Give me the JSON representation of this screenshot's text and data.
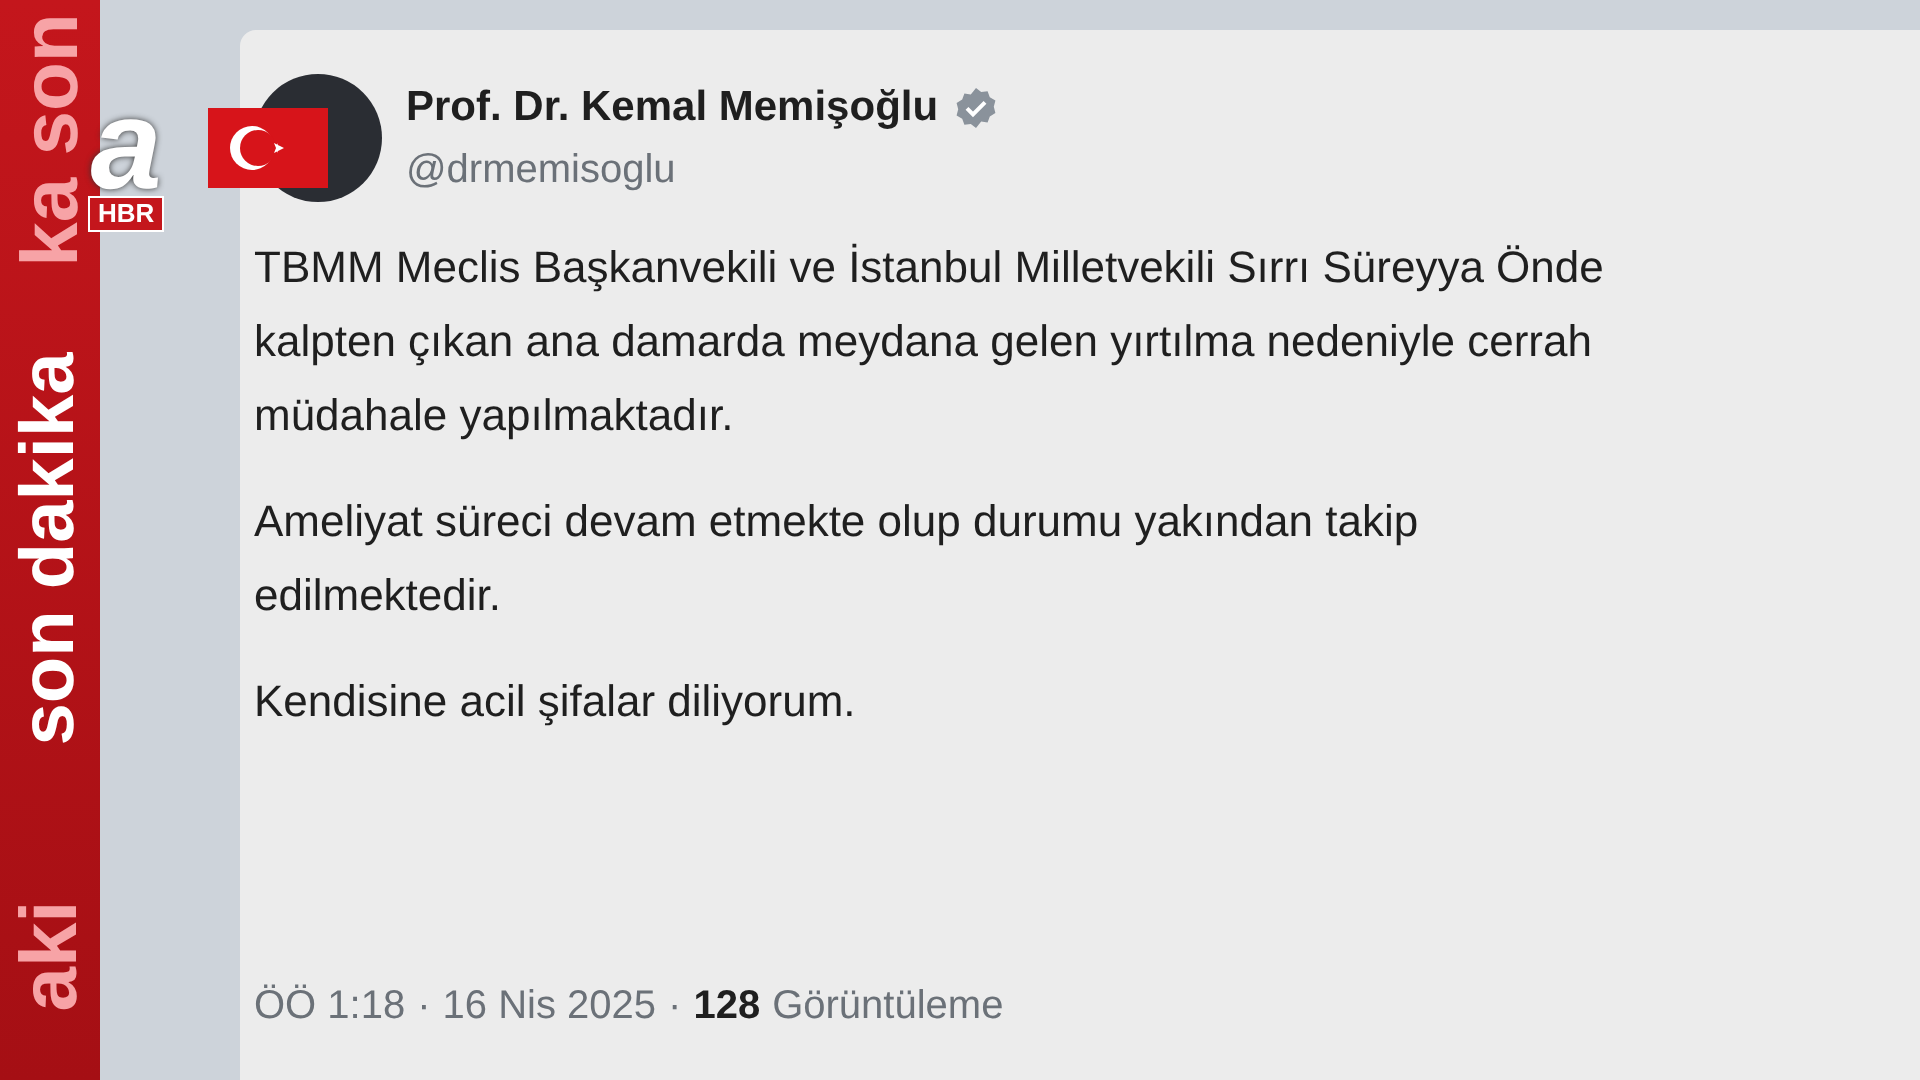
{
  "channel_strip": {
    "label": "son dakika",
    "faded_top": "ka son",
    "faded_bottom": "aki"
  },
  "channel_logo": {
    "letter": "a",
    "badge": "HBR"
  },
  "post": {
    "author": "Prof. Dr. Kemal Memişoğlu",
    "verified": true,
    "handle": "@drmemisoglu",
    "paragraphs": [
      [
        "TBMM Meclis Başkanvekili ve İstanbul Milletvekili Sırrı Süreyya Önde",
        "kalpten çıkan ana damarda meydana gelen yırtılma nedeniyle cerrah",
        "müdahale yapılmaktadır."
      ],
      [
        "Ameliyat süreci devam etmekte olup durumu yakından takip",
        "edilmektedir."
      ],
      [
        "Kendisine acil şifalar diliyorum."
      ]
    ],
    "time": "ÖÖ 1:18",
    "separator": "·",
    "date": "16 Nis 2025",
    "views": "128",
    "views_label": "Görüntüleme"
  }
}
